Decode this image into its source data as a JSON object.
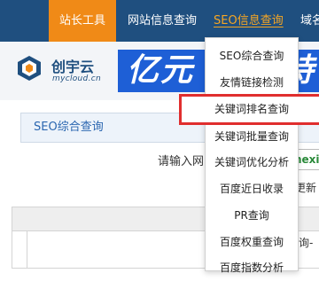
{
  "topnav": {
    "items": [
      {
        "label": "站长工具"
      },
      {
        "label": "网站信息查询"
      },
      {
        "label": "SEO信息查询"
      },
      {
        "label": "域名"
      }
    ]
  },
  "banner": {
    "logo_text": "创宇云",
    "logo_sub": "mycloud.cn",
    "promo_text": "亿元",
    "promo_text2": "持"
  },
  "panel": {
    "title": "SEO综合查询",
    "prompt": "请输入网",
    "input_peek": "nexie",
    "refresh_peek": "更新",
    "table_cell_peek": "查询-"
  },
  "dropdown": {
    "items": [
      {
        "label": "SEO综合查询"
      },
      {
        "label": "友情链接检测"
      },
      {
        "label": "关键词排名查询"
      },
      {
        "label": "关键词批量查询"
      },
      {
        "label": "关键词优化分析"
      },
      {
        "label": "百度近日收录"
      },
      {
        "label": "PR查询"
      },
      {
        "label": "百度权重查询"
      },
      {
        "label": "百度指数分析"
      }
    ],
    "highlighted_color": "#e02e2e"
  },
  "colors": {
    "nav_bg": "#1f4f7f",
    "nav_active": "#f08a17",
    "seo_link": "#f6a623",
    "promo_bg": "#1e5fd6"
  }
}
